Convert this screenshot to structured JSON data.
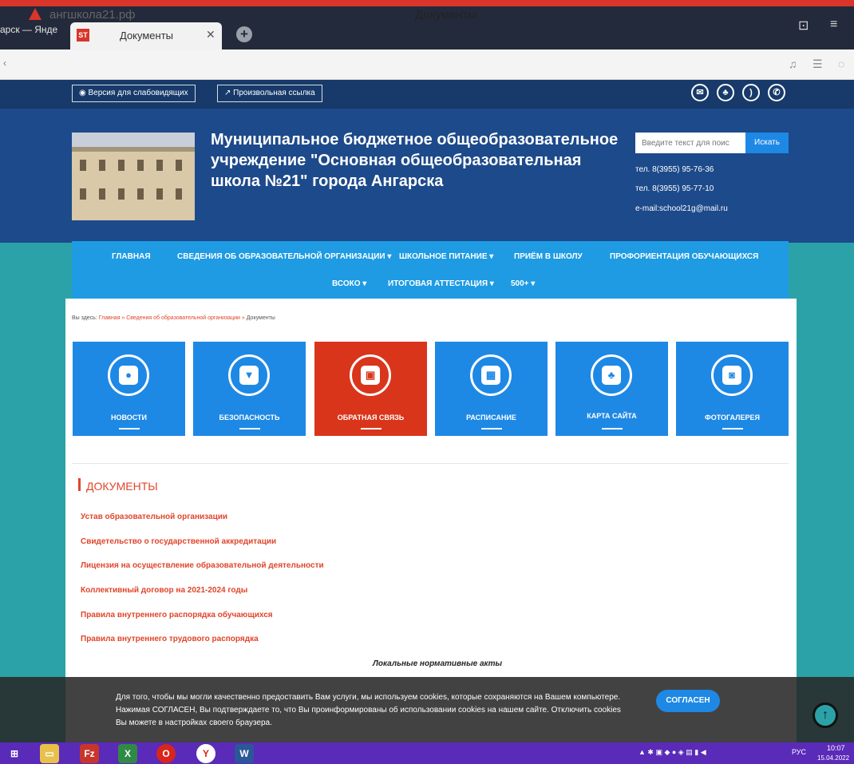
{
  "browser": {
    "prev_tab": "арск — Янде",
    "active_tab": "Документы",
    "favicon_text": "ST",
    "url": "ангшкола21.рф",
    "page_title": "Документы"
  },
  "topbar": {
    "vision_btn": "Версия для слабовидящих",
    "custom_link_btn": "Произвольная ссылка"
  },
  "header": {
    "title": "Муниципальное бюджетное общеобразовательное учреждение \"Основная общеобразовательная школа №21\" города Ангарска",
    "search_placeholder": "Введите текст для поис",
    "search_btn": "Искать",
    "phone1": "тел. 8(3955) 95-76-36",
    "phone2": "тел. 8(3955) 95-77-10",
    "email": "e-mail:school21g@mail.ru"
  },
  "nav": {
    "items": [
      "ГЛАВНАЯ",
      "СВЕДЕНИЯ ОБ ОБРАЗОВАТЕЛЬНОЙ ОРГАНИЗАЦИИ ▾",
      "ШКОЛЬНОЕ ПИТАНИЕ ▾",
      "ПРИЁМ В ШКОЛУ",
      "ПРОФОРИЕНТАЦИЯ ОБУЧАЮЩИХСЯ",
      "ВСОКО ▾",
      "ИТОГОВАЯ АТТЕСТАЦИЯ ▾",
      "500+ ▾"
    ]
  },
  "breadcrumb": {
    "prefix": "Вы здесь:",
    "home": "Главная",
    "section": "Сведения об образовательной организации",
    "current": "Документы"
  },
  "tiles": [
    {
      "label": "НОВОСТИ",
      "icon": "globe-icon"
    },
    {
      "label": "БЕЗОПАСНОСТЬ",
      "icon": "shield-icon"
    },
    {
      "label": "ОБРАТНАЯ СВЯЗЬ",
      "icon": "contact-icon"
    },
    {
      "label": "РАСПИСАНИЕ",
      "icon": "calendar-icon"
    },
    {
      "label": "КАРТА САЙТА",
      "icon": "sitemap-icon"
    },
    {
      "label": "ФОТОГАЛЕРЕЯ",
      "icon": "camera-icon"
    }
  ],
  "docs": {
    "heading": "ДОКУМЕНТЫ",
    "links": [
      "Устав образовательной организации",
      "Свидетельство о государственной аккредитации",
      "Лицензия на осуществление образовательной деятельности",
      "Коллективный договор на 2021-2024 годы",
      "Правила внутреннего распорядка обучающихся",
      "Правила внутреннего трудового распорядка"
    ],
    "local_acts": "Локальные нормативные акты"
  },
  "cookie": {
    "line1": "Для того, чтобы мы могли качественно предоставить Вам услуги, мы используем cookies, которые сохраняются на Вашем компьютере.",
    "line2": "Нажимая СОГЛАСЕН, Вы подтверждаете то, что Вы проинформированы об использовании cookies на нашем сайте. Отключить cookies",
    "line3": "Вы можете в настройках своего браузера.",
    "agree": "СОГЛАСЕН"
  },
  "taskbar": {
    "lang": "РУС",
    "time": "10:07",
    "date": "15.04.2022"
  },
  "colors": {
    "accent_red": "#e0452a",
    "nav_blue": "#1e9be3",
    "header_blue": "#1d4a8a",
    "teal_bg": "#2aa2a8"
  }
}
